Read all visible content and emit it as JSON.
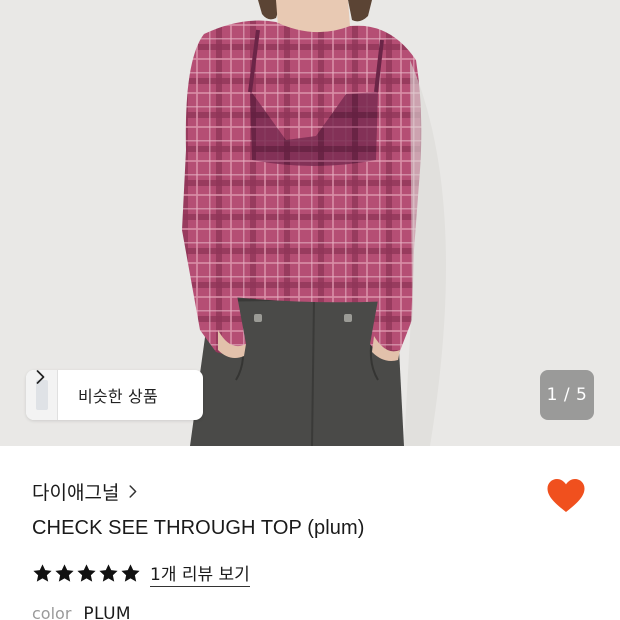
{
  "gallery": {
    "similar_label": "비슷한 상품",
    "pager_text": "1 / 5",
    "product_image": "plum-check-sheer-top-photo"
  },
  "product": {
    "brand": "다이애그널",
    "title": "CHECK SEE THROUGH TOP (plum)",
    "rating": 5,
    "review_link": "1개 리뷰 보기",
    "color_label": "color",
    "color_value": "PLUM",
    "wishlisted": true
  },
  "colors": {
    "accent": "#f0501e",
    "star": "#111111",
    "image_bg": "#e9e8e6"
  },
  "icons": {
    "brand_chevron": "chevron-right-icon",
    "similar_chevron": "chevron-right-icon",
    "wish": "heart-icon",
    "star": "star-icon"
  }
}
